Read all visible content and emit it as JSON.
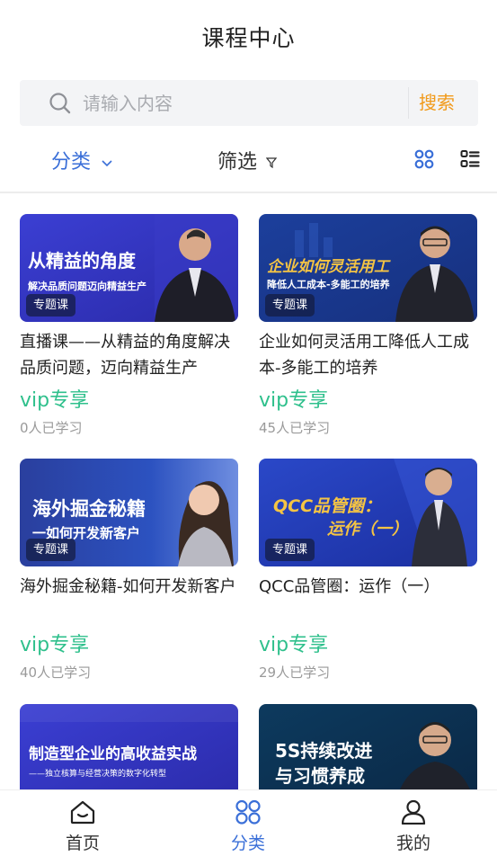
{
  "header": {
    "title": "课程中心"
  },
  "search": {
    "placeholder": "请输入内容",
    "button_label": "搜索"
  },
  "filters": {
    "category_label": "分类",
    "screen_label": "筛选"
  },
  "colors": {
    "accent": "#3a6fd8",
    "vip": "#2fc08c",
    "search_button": "#f19a1b"
  },
  "courses": [
    {
      "title": "直播课——从精益的角度解决品质问题，迈向精益生产",
      "badge": "专题课",
      "price": "vip专享",
      "learners": "0人已学习",
      "thumb_line1": "从精益的角度",
      "thumb_line2": "解决品质问题迈向精益生产"
    },
    {
      "title": "企业如何灵活用工降低人工成本-多能工的培养",
      "badge": "专题课",
      "price": "vip专享",
      "learners": "45人已学习",
      "thumb_line1": "企业如何灵活用工",
      "thumb_line2": "降低人工成本-多能工的培养"
    },
    {
      "title": "海外掘金秘籍-如何开发新客户",
      "badge": "专题课",
      "price": "vip专享",
      "learners": "40人已学习",
      "thumb_line1": "海外掘金秘籍",
      "thumb_line2": "一如何开发新客户"
    },
    {
      "title": "QCC品管圈：运作（一）",
      "badge": "专题课",
      "price": "vip专享",
      "learners": "29人已学习",
      "thumb_line1": "QCC品管圈：",
      "thumb_line2": "运作（一）"
    },
    {
      "thumb_line1": "制造型企业的高收益实战",
      "thumb_line2": "——独立核算与经营决策的数字化转型"
    },
    {
      "thumb_line1": "5S持续改进",
      "thumb_line2": "与习惯养成"
    }
  ],
  "tabbar": {
    "home": "首页",
    "category": "分类",
    "mine": "我的"
  }
}
